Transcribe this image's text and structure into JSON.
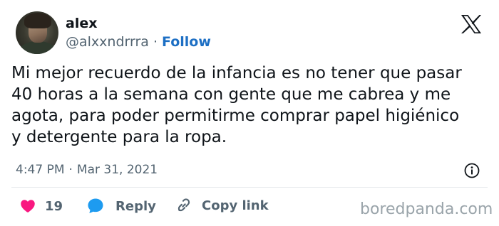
{
  "author": {
    "name": "alex",
    "handle": "@alxxndrrra",
    "separator": "·",
    "follow_label": "Follow"
  },
  "tweet": {
    "lines": [
      "Mi mejor recuerdo de la infancia es no tener que pasar",
      "40 horas a la semana con gente que me cabrea y me",
      "agota, para poder permitirme comprar papel higiénico",
      "y detergente para la ropa."
    ],
    "time": "4:47 PM",
    "separator": "·",
    "date": "Mar 31, 2021"
  },
  "actions": {
    "like_count": "19",
    "reply_label": "Reply",
    "copy_label": "Copy link"
  },
  "watermark": "boredpanda.com",
  "colors": {
    "text": "#0f1419",
    "secondary": "#536471",
    "follow": "#1d6fc4",
    "heart": "#f91880",
    "reply_icon": "#1d9bf0",
    "watermark": "#9aa4aa"
  },
  "icons": {
    "brand": "x-logo-icon",
    "info": "info-icon",
    "like": "heart-icon",
    "reply": "speech-bubble-icon",
    "copy": "link-icon"
  }
}
